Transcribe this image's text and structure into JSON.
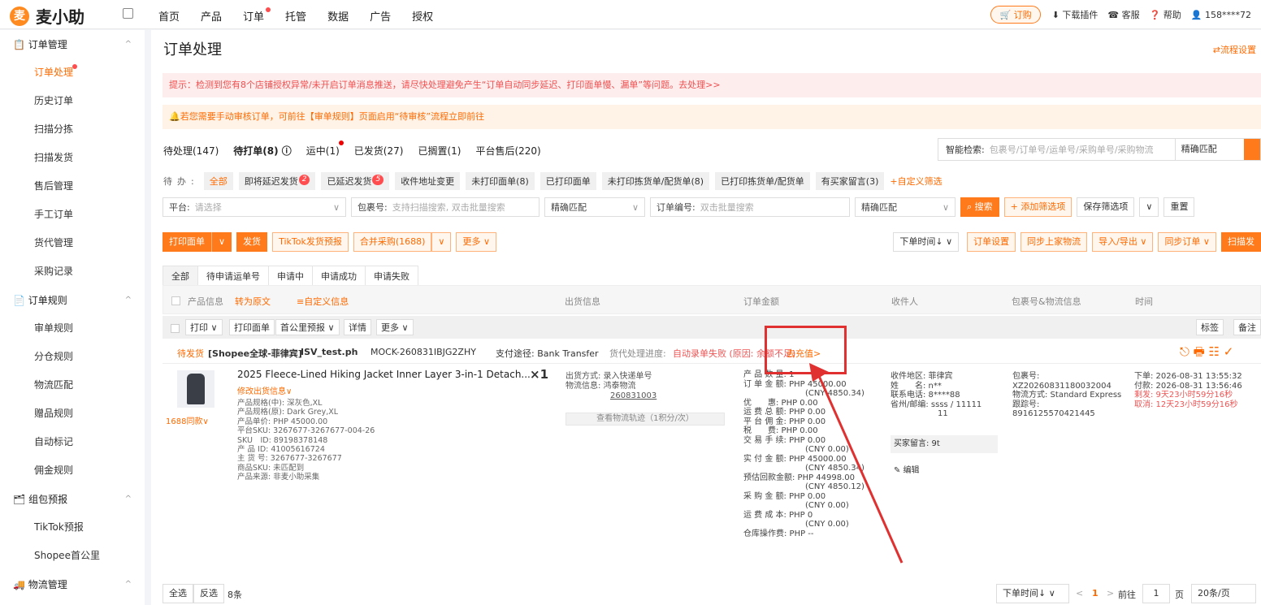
{
  "app": {
    "name": "麦小助",
    "logo_char": "麦"
  },
  "nav": [
    "首页",
    "产品",
    "订单",
    "托管",
    "数据",
    "广告",
    "授权"
  ],
  "topright": {
    "subscribe": "订购",
    "download": "下载插件",
    "service": "客服",
    "help": "帮助",
    "user": "158****72"
  },
  "sidebar": {
    "groups": [
      {
        "title": "订单管理",
        "items": [
          "订单处理",
          "历史订单",
          "扫描分拣",
          "扫描发货",
          "售后管理",
          "手工订单",
          "货代管理",
          "采购记录"
        ]
      },
      {
        "title": "订单规则",
        "items": [
          "审单规则",
          "分仓规则",
          "物流匹配",
          "赠品规则",
          "自动标记",
          "佣金规则"
        ]
      },
      {
        "title": "组包预报",
        "items": [
          "TikTok预报",
          "Shopee首公里"
        ]
      },
      {
        "title": "物流管理",
        "items": []
      }
    ],
    "arrow": "^"
  },
  "page": {
    "title": "订单处理",
    "flow_setting": "流程设置"
  },
  "alerts": {
    "warn1": "提示：检测到您有8个店铺授权异常/未开启订单消息推送，请尽快处理避免产生“订单自动同步延迟、打印面单慢、漏单”等问题。去处理>>",
    "warn2": "若您需要手动审核订单，可前往【审单规则】页面启用“待审核”流程立即前往"
  },
  "tabs": [
    "待处理(147)",
    "待打单(8)",
    "运中(1)",
    "已发货(27)",
    "已搁置(1)",
    "平台售后(220)"
  ],
  "smart_search": {
    "label": "智能检索:",
    "placeholder": "包裹号/订单号/运单号/采购单号/采购物流",
    "match": "精确匹配"
  },
  "pending": {
    "label": "待办:",
    "chips": [
      "全部",
      "即将延迟发货",
      "已延迟发货",
      "收件地址变更",
      "未打印面单(8)",
      "已打印面单",
      "未打印拣货单/配货单(8)",
      "已打印拣货单/配货单",
      "有买家留言(3)"
    ],
    "badge1": "2",
    "badge2": "5",
    "custom": "+自定义筛选"
  },
  "filters": {
    "platform_label": "平台:",
    "platform_ph": "请选择",
    "pkg_label": "包裹号:",
    "pkg_ph": "支持扫描搜索, 双击批量搜索",
    "match": "精确匹配",
    "order_label": "订单编号:",
    "order_ph": "双击批量搜索",
    "search": "搜索",
    "add": "+ 添加筛选项",
    "save": "保存筛选项",
    "reset": "重置"
  },
  "actions": {
    "print": "打印面单",
    "ship": "发货",
    "tiktok": "TikTok发货预报",
    "merge": "合并采购(1688)",
    "more": "更多",
    "sort": "下单时间↓",
    "settings": "订单设置",
    "sync_logi": "同步上家物流",
    "import": "导入/导出",
    "sync": "同步订单",
    "scan": "扫描发"
  },
  "subtabs": [
    "全部",
    "待申请运单号",
    "申请中",
    "申请成功",
    "申请失败"
  ],
  "thead": {
    "product": "产品信息",
    "translate": "转为原文",
    "custom": "≡自定义信息",
    "ship": "出货信息",
    "amount": "订单金额",
    "receiver": "收件人",
    "pkg": "包裹号&物流信息",
    "time": "时间"
  },
  "bulk": [
    "打印 ∨",
    "打印面单",
    "首公里预报 ∨",
    "详情",
    "更多 ∨"
  ],
  "bulk_right": [
    "标签",
    "备注"
  ],
  "order": {
    "status": "待发货",
    "shop": "[Shopee全球-菲律宾]",
    "store": "ISV_test.ph",
    "id": "MOCK-260831IBJG2ZHY",
    "pay": "支付途径: Bank Transfer",
    "agent": "货代处理进度:",
    "fail": "自动录单失败 (原因: 余额不足)",
    "recharge": "去充值>",
    "title": "2025 Fleece-Lined Hiking Jacket Inner Layer 3-in-1 Detach...",
    "qty": "×1",
    "edit": "修改出货信息∨",
    "similar": "1688同款∨",
    "specs": [
      "产品规格(中): 深灰色,XL",
      "产品规格(原): Dark Grey,XL",
      "产品单价: PHP 45000.00",
      "平台SKU: 3267677-3267677-004-26",
      "SKU　ID: 89198378148",
      "产 品 ID: 41005616724",
      "主 货 号: 3267677-3267677",
      "商品SKU: 未匹配到",
      "产品来源: 非麦小助采集"
    ],
    "ship_method": "出货方式: 录入快递单号",
    "logi": "物流信息: 鸿泰物流",
    "track_no": "260831003",
    "track_btn": "查看物流轨迹（1积分/次）",
    "amounts": [
      "产 品 数 量: 1",
      "订 单 金 额: PHP 45000.00",
      "(CNY 4850.34)",
      "优　　惠: PHP 0.00",
      "运 费 总 额: PHP 0.00",
      "平 台 佣 金: PHP 0.00",
      "税　　费: PHP 0.00",
      "交 易 手 续: PHP 0.00",
      "(CNY 0.00)",
      "实 付 金 额: PHP 45000.00",
      "(CNY 4850.34)",
      "预估回款金额: PHP 44998.00",
      "(CNY 4850.12)",
      "采 购 金 额: PHP 0.00",
      "(CNY 0.00)",
      "运 费 成 本: PHP 0",
      "(CNY 0.00)",
      "仓库操作费: PHP --"
    ],
    "receiver": [
      "收件地区: 菲律宾",
      "姓　　名: n**",
      "联系电话: 8****88",
      "省州/邮编: ssss / 11111",
      "11"
    ],
    "buyer_msg": "买家留言: 9t",
    "edit2": "编辑",
    "pkg": [
      "包裹号:",
      "XZ2026083118003200​4",
      "物流方式: Standard Express",
      "跟踪号:",
      "8916125570421445"
    ],
    "times": [
      "下单: 2026-08-31 13:55:32",
      "付款: 2026-08-31 13:56:46",
      "剩发: 9天23小时59分16秒",
      "取消: 12天23小时59分16秒"
    ]
  },
  "footer": {
    "all": "全选",
    "invert": "反选",
    "count": "8条",
    "sort": "下单时间↓",
    "page": "1",
    "goto": "前往",
    "page_label": "页",
    "per": "20条/页"
  },
  "colors": {
    "accent": "#ff7a1a",
    "alert_red": "#e03030"
  }
}
